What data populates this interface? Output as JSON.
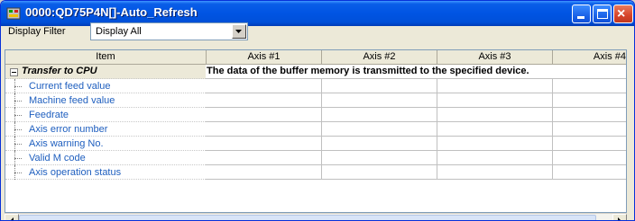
{
  "window": {
    "title": "0000:QD75P4N[]-Auto_Refresh",
    "close_glyph": "×"
  },
  "filter": {
    "label": "Display Filter",
    "value": "Display All"
  },
  "table": {
    "columns": [
      "Item",
      "Axis #1",
      "Axis #2",
      "Axis #3",
      "Axis #4"
    ],
    "group": {
      "label": "Transfer to CPU",
      "message": "The data of the buffer memory is transmitted to the specified device."
    },
    "rows": [
      "Current feed value",
      "Machine feed value",
      "Feedrate",
      "Axis error number",
      "Axis warning No.",
      "Valid M code",
      "Axis operation status"
    ]
  },
  "colors": {
    "titlebar": "#0054e3",
    "item_text": "#1f5fbf",
    "window_bg": "#ece9d8"
  },
  "icons": {
    "app": "app-icon",
    "dropdown": "chevron-down-icon",
    "collapse": "minus-box-icon",
    "scroll_left": "arrow-left-icon",
    "scroll_right": "arrow-right-icon"
  }
}
